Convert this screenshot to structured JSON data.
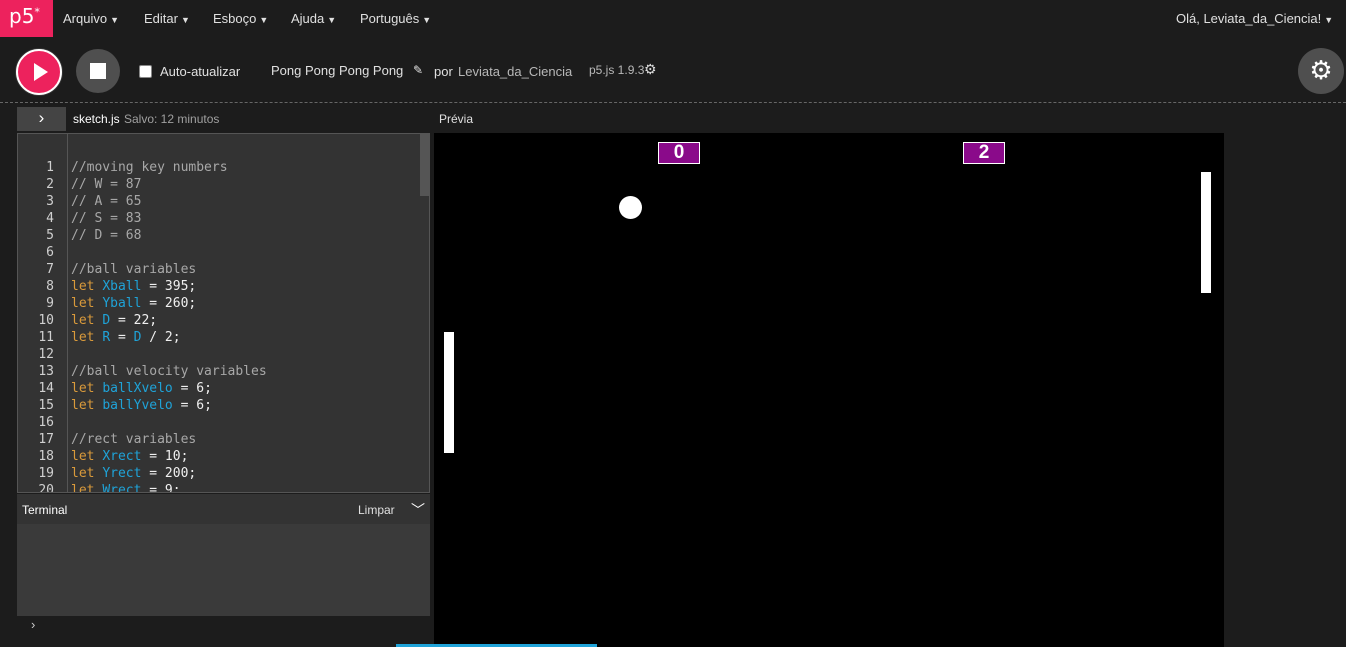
{
  "nav": {
    "logo": "p5",
    "logo_sup": "*",
    "menus": [
      "Arquivo",
      "Editar",
      "Esboço",
      "Ajuda",
      "Português"
    ],
    "user": "Olá, Leviata_da_Ciencia!"
  },
  "toolbar": {
    "autorefresh_label": "Auto-atualizar",
    "sketch_name": "Pong Pong Pong Pong",
    "by_label": "por",
    "author": "Leviata_da_Ciencia",
    "version": "p5.js 1.9.3"
  },
  "editor": {
    "filename": "sketch.js",
    "saved": "Salvo: 12 minutos",
    "lines": [
      {
        "n": "1",
        "parts": [
          {
            "t": "//moving key numbers",
            "c": "cm"
          }
        ]
      },
      {
        "n": "2",
        "parts": [
          {
            "t": "// W = 87",
            "c": "cm"
          }
        ]
      },
      {
        "n": "3",
        "parts": [
          {
            "t": "// A = 65",
            "c": "cm"
          }
        ]
      },
      {
        "n": "4",
        "parts": [
          {
            "t": "// S = 83",
            "c": "cm"
          }
        ]
      },
      {
        "n": "5",
        "parts": [
          {
            "t": "// D = 68",
            "c": "cm"
          }
        ]
      },
      {
        "n": "6",
        "parts": []
      },
      {
        "n": "7",
        "parts": [
          {
            "t": "//ball variables",
            "c": "cm"
          }
        ]
      },
      {
        "n": "8",
        "parts": [
          {
            "t": "let ",
            "c": "kw"
          },
          {
            "t": "Xball",
            "c": "var"
          },
          {
            "t": " = 395;",
            "c": ""
          }
        ]
      },
      {
        "n": "9",
        "parts": [
          {
            "t": "let ",
            "c": "kw"
          },
          {
            "t": "Yball",
            "c": "var"
          },
          {
            "t": " = 260;",
            "c": ""
          }
        ]
      },
      {
        "n": "10",
        "parts": [
          {
            "t": "let ",
            "c": "kw"
          },
          {
            "t": "D",
            "c": "var"
          },
          {
            "t": " = 22;",
            "c": ""
          }
        ]
      },
      {
        "n": "11",
        "parts": [
          {
            "t": "let ",
            "c": "kw"
          },
          {
            "t": "R",
            "c": "var"
          },
          {
            "t": " = ",
            "c": ""
          },
          {
            "t": "D",
            "c": "var"
          },
          {
            "t": " / 2;",
            "c": ""
          }
        ]
      },
      {
        "n": "12",
        "parts": []
      },
      {
        "n": "13",
        "parts": [
          {
            "t": "//ball velocity variables",
            "c": "cm"
          }
        ]
      },
      {
        "n": "14",
        "parts": [
          {
            "t": "let ",
            "c": "kw"
          },
          {
            "t": "ballXvelo",
            "c": "var"
          },
          {
            "t": " = 6;",
            "c": ""
          }
        ]
      },
      {
        "n": "15",
        "parts": [
          {
            "t": "let ",
            "c": "kw"
          },
          {
            "t": "ballYvelo",
            "c": "var"
          },
          {
            "t": " = 6;",
            "c": ""
          }
        ]
      },
      {
        "n": "16",
        "parts": []
      },
      {
        "n": "17",
        "parts": [
          {
            "t": "//rect variables",
            "c": "cm"
          }
        ]
      },
      {
        "n": "18",
        "parts": [
          {
            "t": "let ",
            "c": "kw"
          },
          {
            "t": "Xrect",
            "c": "var"
          },
          {
            "t": " = 10;",
            "c": ""
          }
        ]
      },
      {
        "n": "19",
        "parts": [
          {
            "t": "let ",
            "c": "kw"
          },
          {
            "t": "Yrect",
            "c": "var"
          },
          {
            "t": " = 200;",
            "c": ""
          }
        ]
      },
      {
        "n": "20",
        "parts": [
          {
            "t": "let ",
            "c": "kw"
          },
          {
            "t": "Wrect",
            "c": "var"
          },
          {
            "t": " = 9;",
            "c": ""
          }
        ]
      }
    ]
  },
  "preview_label": "Prévia",
  "terminal": {
    "title": "Terminal",
    "clear_label": "Limpar",
    "prompt": "›"
  },
  "game": {
    "score_left": "0",
    "score_right": "2"
  },
  "colors": {
    "accent": "#ed225d",
    "score_bg": "#8a0a8a",
    "keyword": "#d99a3b",
    "variable": "#1fa3d8"
  }
}
